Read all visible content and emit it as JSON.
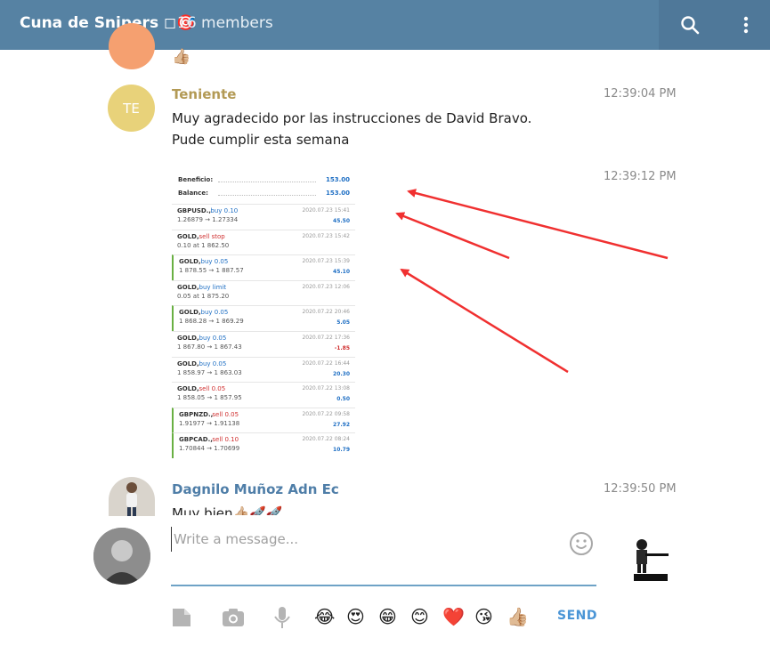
{
  "header": {
    "chat_title": "Cuna de Snipers ◻🎯",
    "members": "16 members"
  },
  "messages": [
    {
      "emoji": "👍🏼"
    },
    {
      "sender": "Teniente",
      "initials": "TE",
      "time": "12:39:04 PM",
      "line1": "Muy agradecido por las instrucciones de David Bravo.",
      "line2": "Pude cumplir esta semana",
      "image_time": "12:39:12 PM"
    },
    {
      "sender": "Dagnilo Muñoz Adn Ec",
      "time": "12:39:50 PM",
      "text": "Muy bien👍🏼🚀🚀"
    }
  ],
  "screenshot": {
    "beneficio_label": "Beneficio:",
    "beneficio_value": "153.00",
    "balance_label": "Balance:",
    "balance_value": "153.00",
    "trades": [
      {
        "sym": "GBPUSD.,",
        "side": "buy 0.10",
        "side_type": "buy",
        "detail": "1.26879 → 1.27334",
        "date": "2020.07.23 15:41",
        "profit": "45.50",
        "profit_type": "pos",
        "bar": false
      },
      {
        "sym": "GOLD,",
        "side": "sell stop",
        "side_type": "sell",
        "detail": "0.10 at 1 862.50",
        "date": "2020.07.23 15:42",
        "profit": "",
        "profit_type": "pos",
        "bar": false
      },
      {
        "sym": "GOLD,",
        "side": "buy 0.05",
        "side_type": "buy",
        "detail": "1 878.55 → 1 887.57",
        "date": "2020.07.23 15:39",
        "profit": "45.10",
        "profit_type": "pos",
        "bar": true
      },
      {
        "sym": "GOLD,",
        "side": "buy limit",
        "side_type": "buy",
        "detail": "0.05 at 1 875.20",
        "date": "2020.07.23 12:06",
        "profit": "",
        "profit_type": "pos",
        "bar": false
      },
      {
        "sym": "GOLD,",
        "side": "buy 0.05",
        "side_type": "buy",
        "detail": "1 868.28 → 1 869.29",
        "date": "2020.07.22 20:46",
        "profit": "5.05",
        "profit_type": "pos",
        "bar": true
      },
      {
        "sym": "GOLD,",
        "side": "buy 0.05",
        "side_type": "buy",
        "detail": "1 867.80 → 1 867.43",
        "date": "2020.07.22 17:36",
        "profit": "-1.85",
        "profit_type": "neg",
        "bar": false
      },
      {
        "sym": "GOLD,",
        "side": "buy 0.05",
        "side_type": "buy",
        "detail": "1 858.97 → 1 863.03",
        "date": "2020.07.22 16:44",
        "profit": "20.30",
        "profit_type": "pos",
        "bar": false
      },
      {
        "sym": "GOLD,",
        "side": "sell 0.05",
        "side_type": "sell",
        "detail": "1 858.05 → 1 857.95",
        "date": "2020.07.22 13:08",
        "profit": "0.50",
        "profit_type": "pos",
        "bar": false
      },
      {
        "sym": "GBPNZD.,",
        "side": "sell 0.05",
        "side_type": "sell",
        "detail": "1.91977 → 1.91138",
        "date": "2020.07.22 09:58",
        "profit": "27.92",
        "profit_type": "pos",
        "bar": true
      },
      {
        "sym": "GBPCAD.,",
        "side": "sell 0.10",
        "side_type": "sell",
        "detail": "1.70844 → 1.70699",
        "date": "2020.07.22 08:24",
        "profit": "10.79",
        "profit_type": "pos",
        "bar": true
      }
    ]
  },
  "composer": {
    "placeholder": "Write a message...",
    "send_label": "SEND",
    "quick_emojis": [
      "😂",
      "😍",
      "😁",
      "😊",
      "❤️",
      "😘",
      "👍🏼"
    ]
  },
  "colors": {
    "header_bg": "#5682a3",
    "teniente_name": "#b39a55",
    "teniente_avatar": "#e8d27a",
    "dagnilo_name": "#4f7ea8",
    "send": "#4a95d6",
    "arrow": "#f03030",
    "buy": "#1f6fc4",
    "sell": "#d03030",
    "profit_bar": "#69b043"
  },
  "icons": {
    "search": "search-icon",
    "more": "more-vertical-icon",
    "emoji_picker": "smiley-icon",
    "attach": "file-icon",
    "camera": "camera-icon",
    "mic": "microphone-icon"
  }
}
